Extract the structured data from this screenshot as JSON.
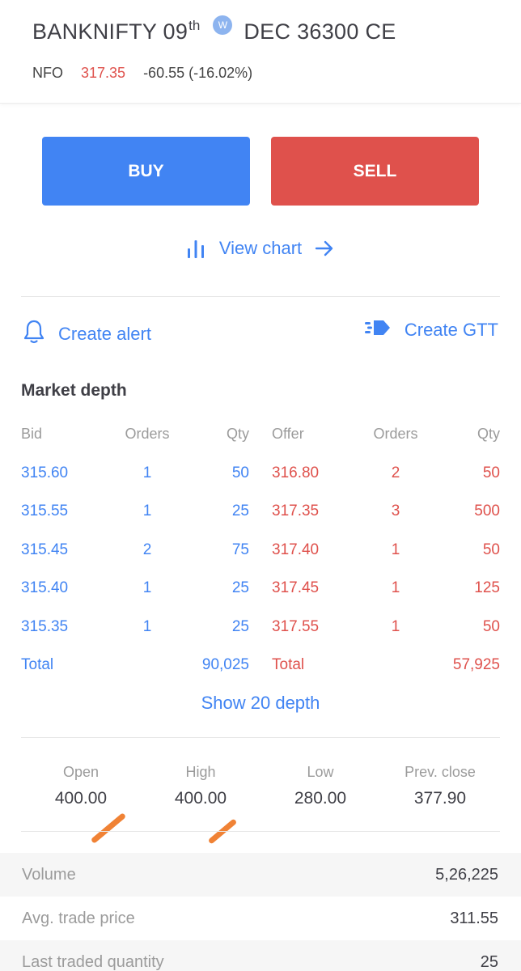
{
  "header": {
    "title_prefix": "BANKNIFTY 09",
    "title_sup": "th",
    "title_suffix": "DEC 36300 CE",
    "badge": "W",
    "exchange": "NFO",
    "ltp": "317.35",
    "change": "-60.55 (-16.02%)"
  },
  "actions": {
    "buy_label": "BUY",
    "sell_label": "SELL",
    "view_chart_label": "View chart",
    "create_alert_label": "Create alert",
    "create_gtt_label": "Create GTT"
  },
  "market_depth": {
    "title": "Market depth",
    "headers": [
      "Bid",
      "Orders",
      "Qty",
      "Offer",
      "Orders",
      "Qty"
    ],
    "rows": [
      {
        "bid": "315.60",
        "bid_orders": "1",
        "bid_qty": "50",
        "offer": "316.80",
        "offer_orders": "2",
        "offer_qty": "50"
      },
      {
        "bid": "315.55",
        "bid_orders": "1",
        "bid_qty": "25",
        "offer": "317.35",
        "offer_orders": "3",
        "offer_qty": "500"
      },
      {
        "bid": "315.45",
        "bid_orders": "2",
        "bid_qty": "75",
        "offer": "317.40",
        "offer_orders": "1",
        "offer_qty": "50"
      },
      {
        "bid": "315.40",
        "bid_orders": "1",
        "bid_qty": "25",
        "offer": "317.45",
        "offer_orders": "1",
        "offer_qty": "125"
      },
      {
        "bid": "315.35",
        "bid_orders": "1",
        "bid_qty": "25",
        "offer": "317.55",
        "offer_orders": "1",
        "offer_qty": "50"
      }
    ],
    "total_label": "Total",
    "total_bid_qty": "90,025",
    "total_offer_label": "Total",
    "total_offer_qty": "57,925",
    "show_more_label": "Show 20 depth"
  },
  "ohlc": [
    {
      "label": "Open",
      "value": "400.00"
    },
    {
      "label": "High",
      "value": "400.00"
    },
    {
      "label": "Low",
      "value": "280.00"
    },
    {
      "label": "Prev. close",
      "value": "377.90"
    }
  ],
  "stats": [
    {
      "label": "Volume",
      "value": "5,26,225"
    },
    {
      "label": "Avg. trade price",
      "value": "311.55"
    },
    {
      "label": "Last traded quantity",
      "value": "25"
    }
  ],
  "colors": {
    "buy": "#4184f3",
    "sell": "#df514c",
    "annotation": "#f08235"
  },
  "icons": {
    "chart": "bar-chart-icon",
    "arrow": "arrow-right-icon",
    "alert": "bell-icon",
    "gtt": "gtt-icon"
  }
}
